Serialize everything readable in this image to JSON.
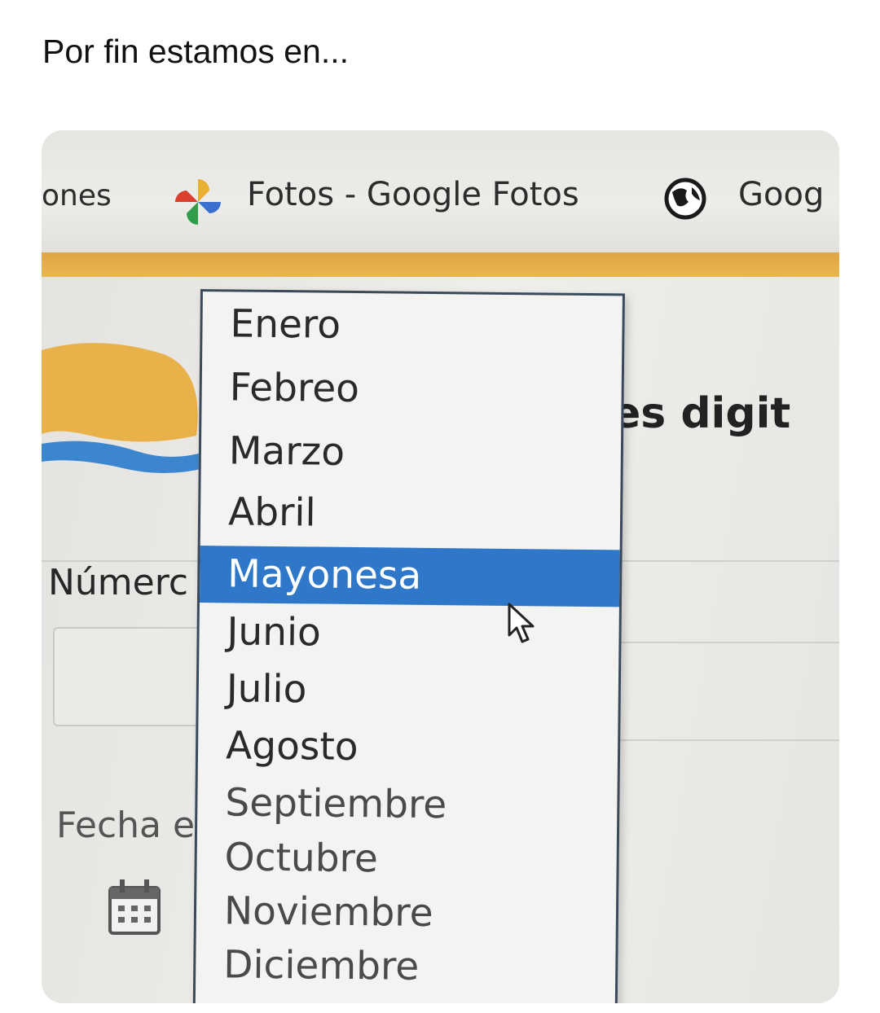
{
  "caption": "Por fin estamos en...",
  "bookmarks": [
    {
      "label": "ones"
    },
    {
      "label": "Fotos - Google Fotos",
      "icon": "google-photos-pinwheel-icon"
    },
    {
      "label": "Goog",
      "icon": "globe-icon"
    }
  ],
  "page": {
    "heading_fragment": "es digit",
    "numero_label": "Númerc",
    "fecha_label": "Fecha e"
  },
  "dropdown": {
    "options": [
      "Enero",
      "Febreo",
      "Marzo",
      "Abril",
      "Mayonesa",
      "Junio",
      "Julio",
      "Agosto",
      "Septiembre",
      "Octubre",
      "Noviembre",
      "Diciembre"
    ],
    "selected": "Mayonesa"
  },
  "colors": {
    "selection": "#2f77c9",
    "orange_bar": "#e0a644"
  }
}
